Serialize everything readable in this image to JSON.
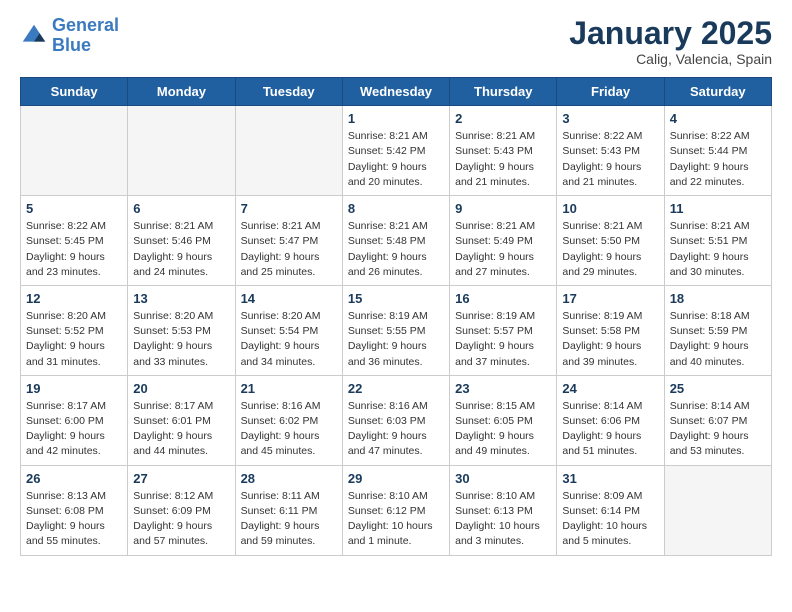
{
  "header": {
    "logo_line1": "General",
    "logo_line2": "Blue",
    "month": "January 2025",
    "location": "Calig, Valencia, Spain"
  },
  "weekdays": [
    "Sunday",
    "Monday",
    "Tuesday",
    "Wednesday",
    "Thursday",
    "Friday",
    "Saturday"
  ],
  "weeks": [
    [
      {
        "day": "",
        "info": ""
      },
      {
        "day": "",
        "info": ""
      },
      {
        "day": "",
        "info": ""
      },
      {
        "day": "1",
        "info": "Sunrise: 8:21 AM\nSunset: 5:42 PM\nDaylight: 9 hours\nand 20 minutes."
      },
      {
        "day": "2",
        "info": "Sunrise: 8:21 AM\nSunset: 5:43 PM\nDaylight: 9 hours\nand 21 minutes."
      },
      {
        "day": "3",
        "info": "Sunrise: 8:22 AM\nSunset: 5:43 PM\nDaylight: 9 hours\nand 21 minutes."
      },
      {
        "day": "4",
        "info": "Sunrise: 8:22 AM\nSunset: 5:44 PM\nDaylight: 9 hours\nand 22 minutes."
      }
    ],
    [
      {
        "day": "5",
        "info": "Sunrise: 8:22 AM\nSunset: 5:45 PM\nDaylight: 9 hours\nand 23 minutes."
      },
      {
        "day": "6",
        "info": "Sunrise: 8:21 AM\nSunset: 5:46 PM\nDaylight: 9 hours\nand 24 minutes."
      },
      {
        "day": "7",
        "info": "Sunrise: 8:21 AM\nSunset: 5:47 PM\nDaylight: 9 hours\nand 25 minutes."
      },
      {
        "day": "8",
        "info": "Sunrise: 8:21 AM\nSunset: 5:48 PM\nDaylight: 9 hours\nand 26 minutes."
      },
      {
        "day": "9",
        "info": "Sunrise: 8:21 AM\nSunset: 5:49 PM\nDaylight: 9 hours\nand 27 minutes."
      },
      {
        "day": "10",
        "info": "Sunrise: 8:21 AM\nSunset: 5:50 PM\nDaylight: 9 hours\nand 29 minutes."
      },
      {
        "day": "11",
        "info": "Sunrise: 8:21 AM\nSunset: 5:51 PM\nDaylight: 9 hours\nand 30 minutes."
      }
    ],
    [
      {
        "day": "12",
        "info": "Sunrise: 8:20 AM\nSunset: 5:52 PM\nDaylight: 9 hours\nand 31 minutes."
      },
      {
        "day": "13",
        "info": "Sunrise: 8:20 AM\nSunset: 5:53 PM\nDaylight: 9 hours\nand 33 minutes."
      },
      {
        "day": "14",
        "info": "Sunrise: 8:20 AM\nSunset: 5:54 PM\nDaylight: 9 hours\nand 34 minutes."
      },
      {
        "day": "15",
        "info": "Sunrise: 8:19 AM\nSunset: 5:55 PM\nDaylight: 9 hours\nand 36 minutes."
      },
      {
        "day": "16",
        "info": "Sunrise: 8:19 AM\nSunset: 5:57 PM\nDaylight: 9 hours\nand 37 minutes."
      },
      {
        "day": "17",
        "info": "Sunrise: 8:19 AM\nSunset: 5:58 PM\nDaylight: 9 hours\nand 39 minutes."
      },
      {
        "day": "18",
        "info": "Sunrise: 8:18 AM\nSunset: 5:59 PM\nDaylight: 9 hours\nand 40 minutes."
      }
    ],
    [
      {
        "day": "19",
        "info": "Sunrise: 8:17 AM\nSunset: 6:00 PM\nDaylight: 9 hours\nand 42 minutes."
      },
      {
        "day": "20",
        "info": "Sunrise: 8:17 AM\nSunset: 6:01 PM\nDaylight: 9 hours\nand 44 minutes."
      },
      {
        "day": "21",
        "info": "Sunrise: 8:16 AM\nSunset: 6:02 PM\nDaylight: 9 hours\nand 45 minutes."
      },
      {
        "day": "22",
        "info": "Sunrise: 8:16 AM\nSunset: 6:03 PM\nDaylight: 9 hours\nand 47 minutes."
      },
      {
        "day": "23",
        "info": "Sunrise: 8:15 AM\nSunset: 6:05 PM\nDaylight: 9 hours\nand 49 minutes."
      },
      {
        "day": "24",
        "info": "Sunrise: 8:14 AM\nSunset: 6:06 PM\nDaylight: 9 hours\nand 51 minutes."
      },
      {
        "day": "25",
        "info": "Sunrise: 8:14 AM\nSunset: 6:07 PM\nDaylight: 9 hours\nand 53 minutes."
      }
    ],
    [
      {
        "day": "26",
        "info": "Sunrise: 8:13 AM\nSunset: 6:08 PM\nDaylight: 9 hours\nand 55 minutes."
      },
      {
        "day": "27",
        "info": "Sunrise: 8:12 AM\nSunset: 6:09 PM\nDaylight: 9 hours\nand 57 minutes."
      },
      {
        "day": "28",
        "info": "Sunrise: 8:11 AM\nSunset: 6:11 PM\nDaylight: 9 hours\nand 59 minutes."
      },
      {
        "day": "29",
        "info": "Sunrise: 8:10 AM\nSunset: 6:12 PM\nDaylight: 10 hours\nand 1 minute."
      },
      {
        "day": "30",
        "info": "Sunrise: 8:10 AM\nSunset: 6:13 PM\nDaylight: 10 hours\nand 3 minutes."
      },
      {
        "day": "31",
        "info": "Sunrise: 8:09 AM\nSunset: 6:14 PM\nDaylight: 10 hours\nand 5 minutes."
      },
      {
        "day": "",
        "info": ""
      }
    ]
  ]
}
